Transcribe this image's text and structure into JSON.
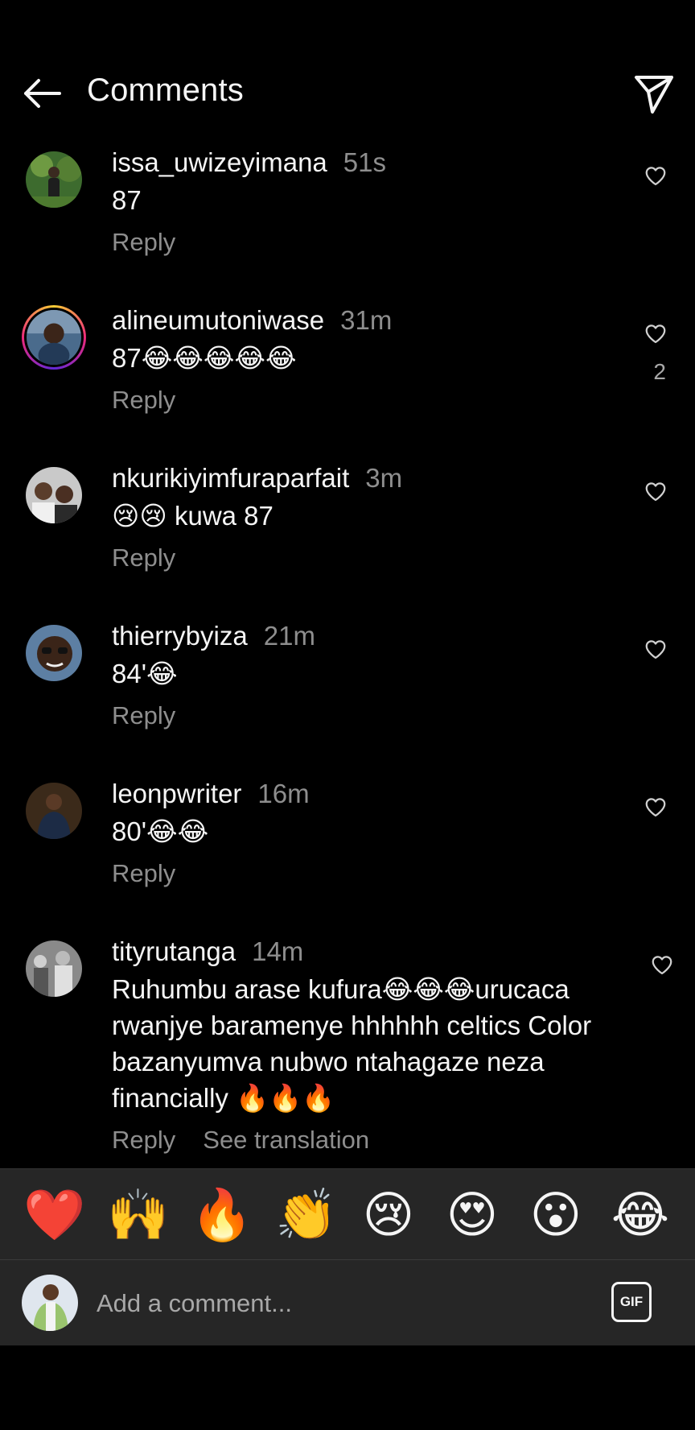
{
  "header": {
    "title": "Comments"
  },
  "comments": [
    {
      "username": "issa_uwizeyimana",
      "time": "51s",
      "text": "87",
      "reply": "Reply",
      "likes": ""
    },
    {
      "username": "alineumutoniwase",
      "time": "31m",
      "text": "87😂😂😂😂😂",
      "reply": "Reply",
      "likes": "2"
    },
    {
      "username": "nkurikiyimfuraparfait",
      "time": "3m",
      "text": "😢😢 kuwa 87",
      "reply": "Reply",
      "likes": ""
    },
    {
      "username": "thierrybyiza",
      "time": "21m",
      "text": "84'😂",
      "reply": "Reply",
      "likes": ""
    },
    {
      "username": "leonpwriter",
      "time": "16m",
      "text": "80'😂😂",
      "reply": "Reply",
      "likes": ""
    },
    {
      "username": "tityrutanga",
      "time": "14m",
      "text": "Ruhumbu arase kufura😂😂😂urucaca rwanjye baramenye hhhhhh celtics Color bazanyumva nubwo ntahagaze neza financially 🔥🔥🔥",
      "reply": "Reply",
      "see_translation": "See translation",
      "likes": ""
    }
  ],
  "emoji_bar": [
    "❤️",
    "🙌",
    "🔥",
    "👏",
    "😢",
    "😍",
    "😮",
    "😂"
  ],
  "composer": {
    "placeholder": "Add a comment...",
    "gif_label": "GIF"
  },
  "colors": {
    "background": "#000000",
    "text": "#f5f5f5",
    "muted": "#8e8e8e",
    "bar": "#262626"
  }
}
